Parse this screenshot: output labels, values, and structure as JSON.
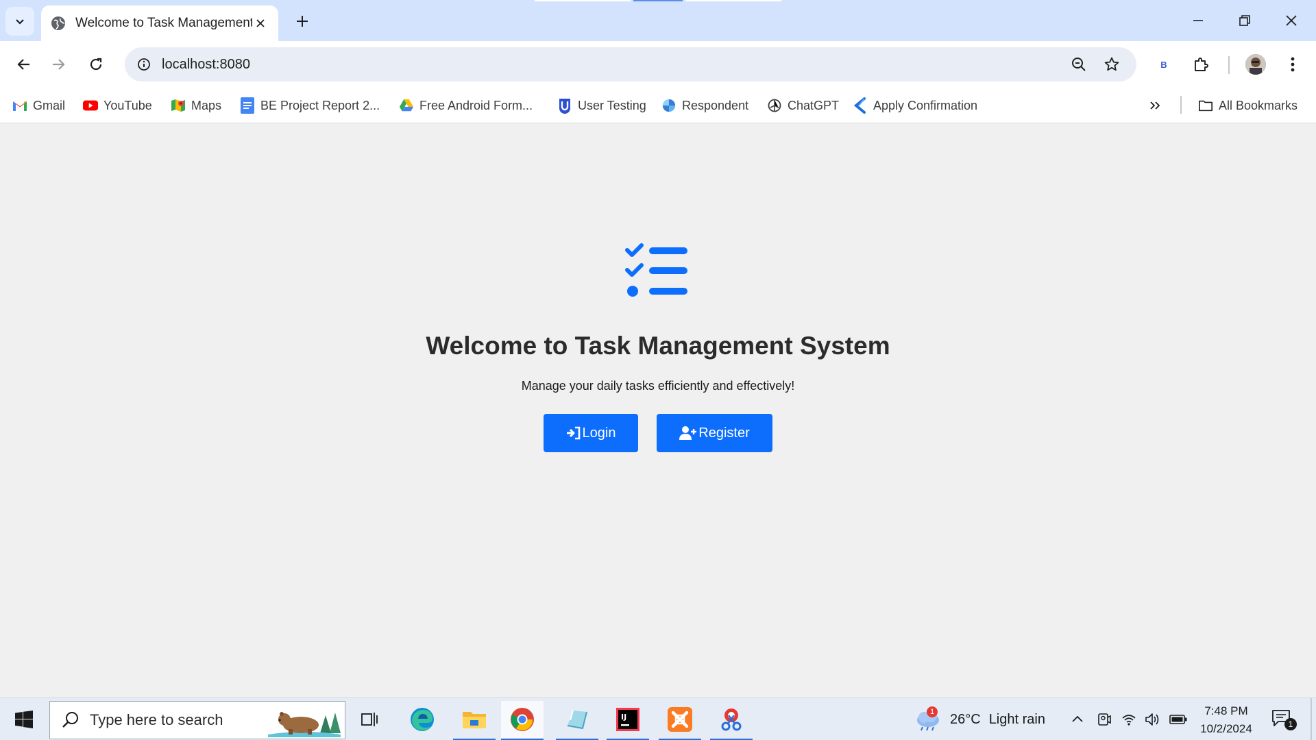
{
  "browser": {
    "tab": {
      "title": "Welcome to Task Management"
    },
    "address": {
      "url": "localhost:8080"
    },
    "extension_badge": "B",
    "bookmarks": [
      {
        "label": "Gmail",
        "icon": "gmail-icon"
      },
      {
        "label": "YouTube",
        "icon": "youtube-icon"
      },
      {
        "label": "Maps",
        "icon": "maps-icon"
      },
      {
        "label": "BE Project Report 2...",
        "icon": "docs-icon"
      },
      {
        "label": "Free Android Form...",
        "icon": "drive-icon"
      },
      {
        "label": "User Testing",
        "icon": "usertesting-icon"
      },
      {
        "label": "Respondent",
        "icon": "respondent-icon"
      },
      {
        "label": "ChatGPT",
        "icon": "chatgpt-icon"
      },
      {
        "label": "Apply Confirmation",
        "icon": "apply-icon"
      }
    ],
    "all_bookmarks_label": "All Bookmarks"
  },
  "page": {
    "title": "Welcome to Task Management System",
    "subtitle": "Manage your daily tasks efficiently and effectively!",
    "login_label": "Login",
    "register_label": "Register",
    "accent_color": "#0d6efd"
  },
  "taskbar": {
    "search_placeholder": "Type here to search",
    "weather": {
      "temp": "26°C",
      "condition": "Light rain",
      "badge": "1"
    },
    "clock": {
      "time": "7:48 PM",
      "date": "10/2/2024"
    },
    "notification_count": "1",
    "apps": [
      "task-view",
      "edge",
      "file-explorer",
      "chrome",
      "app",
      "intellij",
      "xampp",
      "snipping-tool"
    ]
  }
}
